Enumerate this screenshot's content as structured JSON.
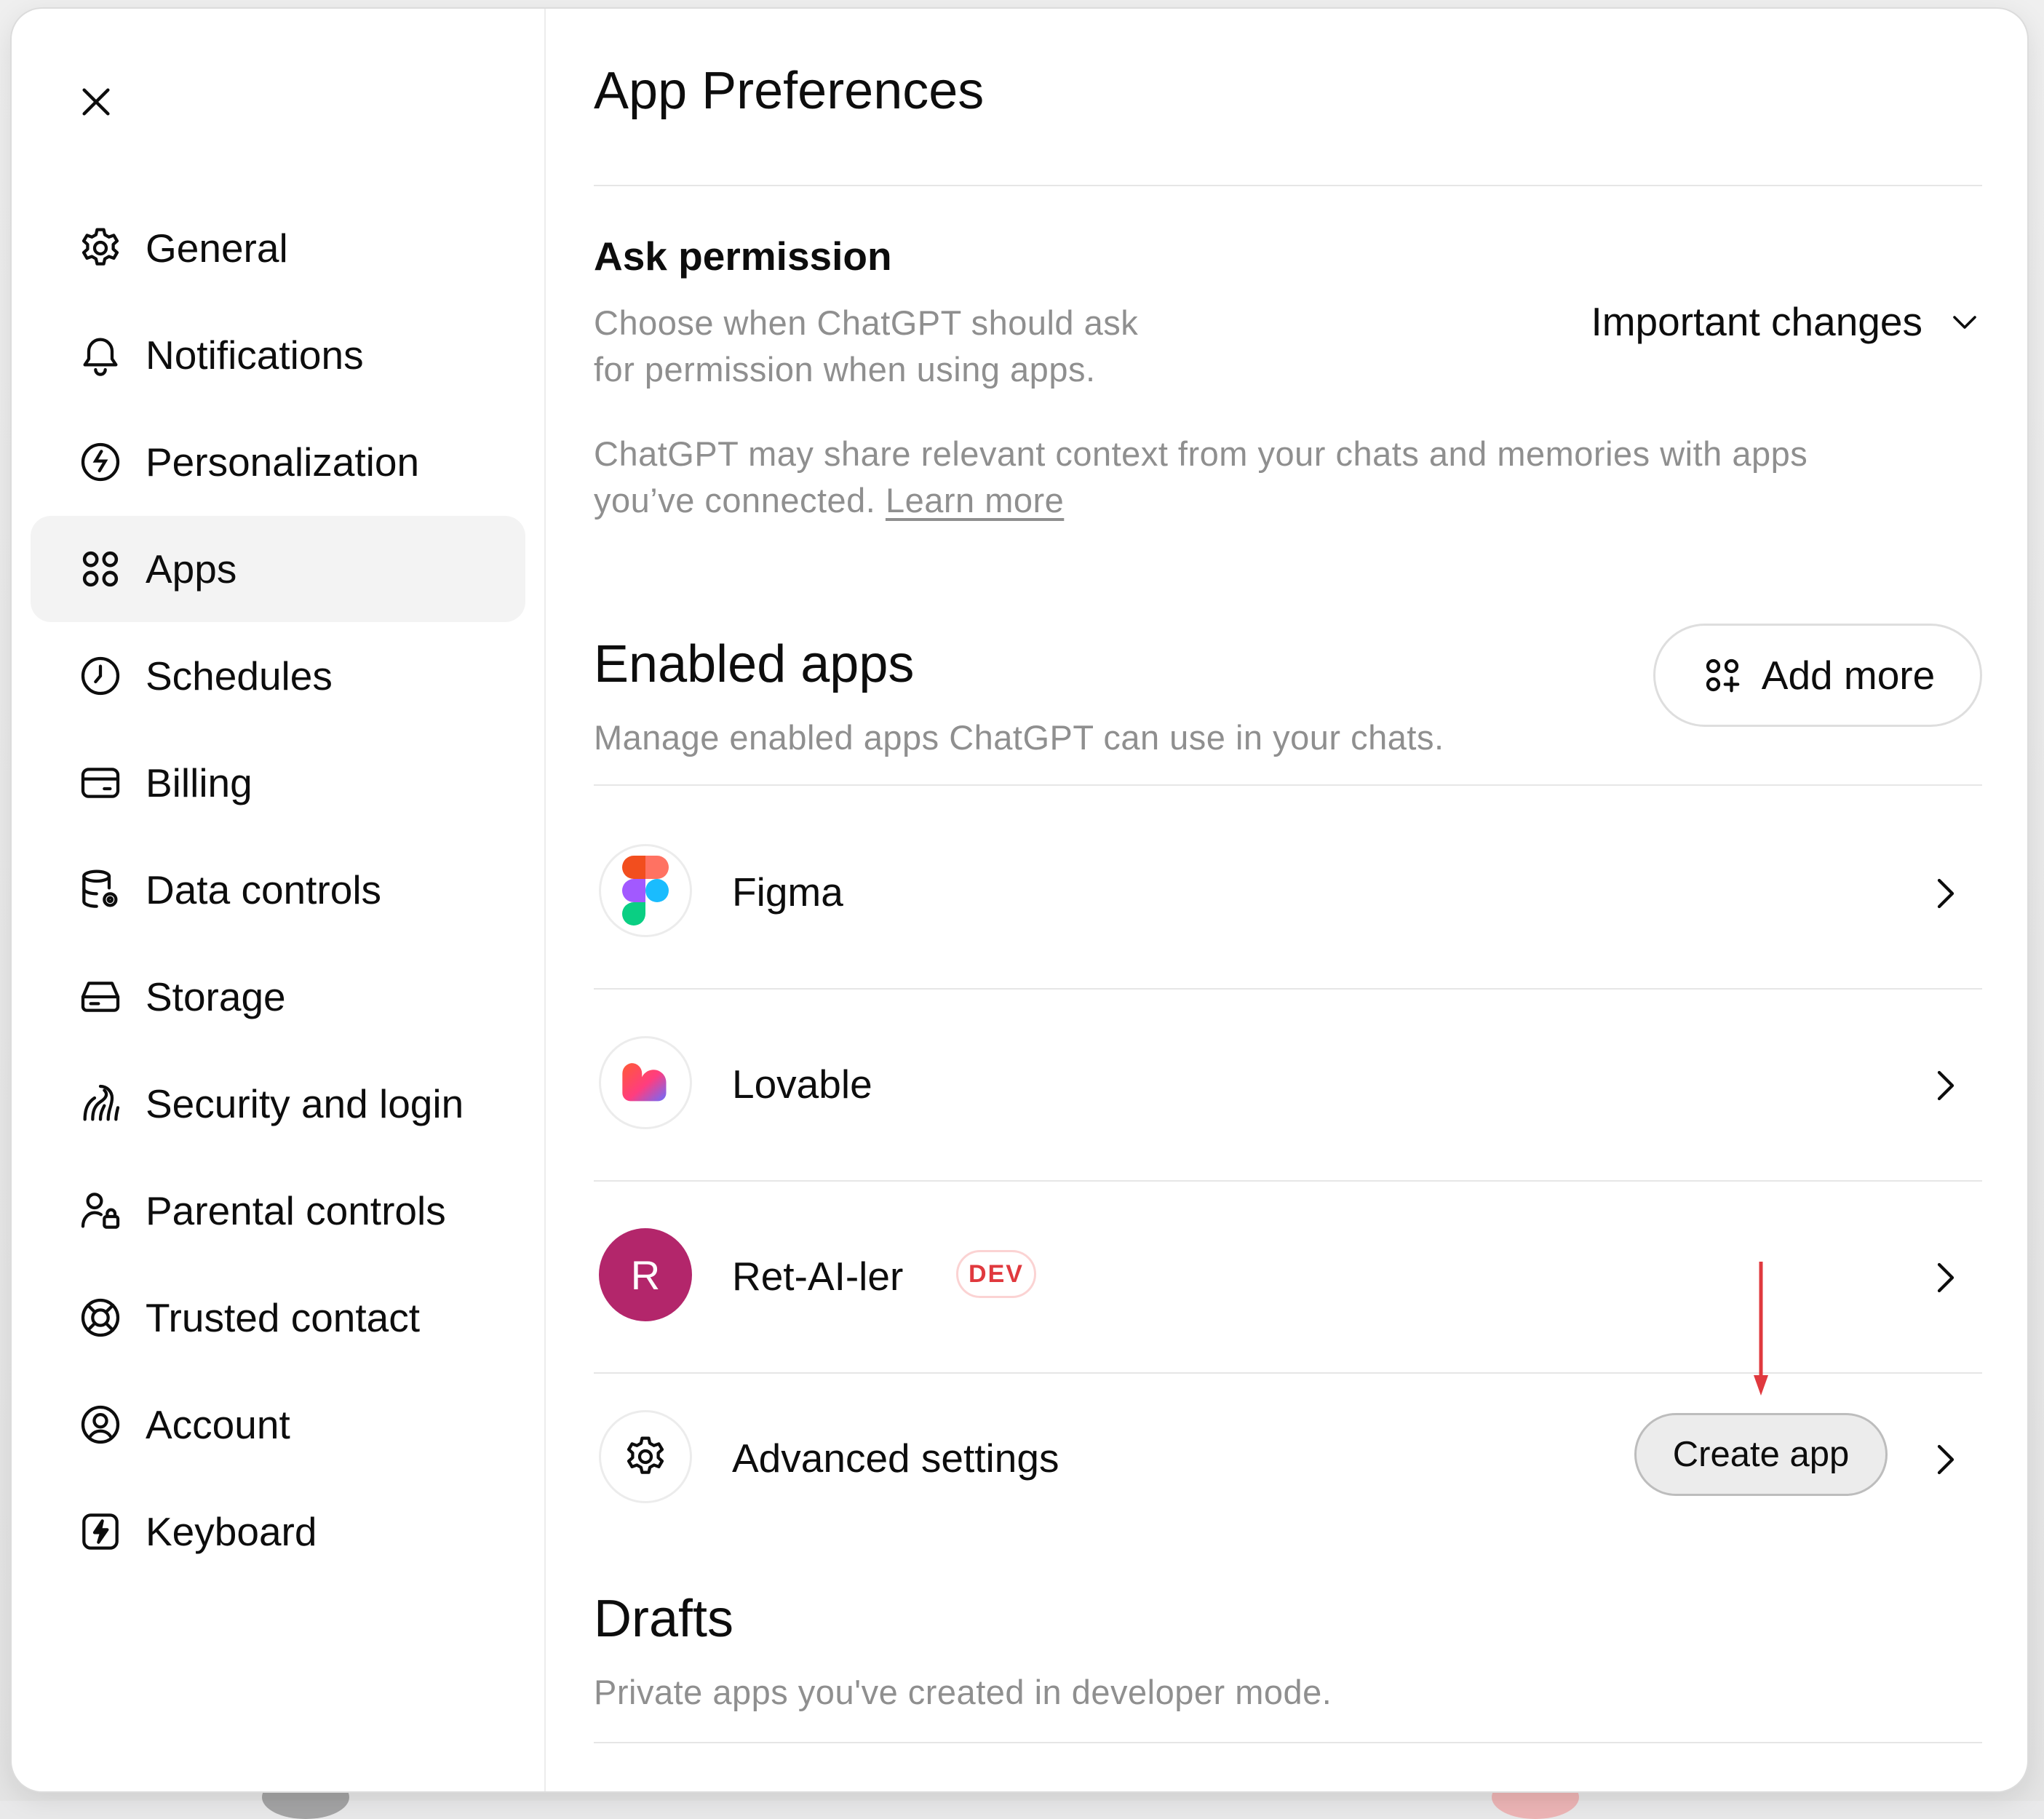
{
  "window": {
    "title": "App Preferences"
  },
  "sidebar": {
    "items": [
      {
        "label": "General",
        "icon": "gear-icon"
      },
      {
        "label": "Notifications",
        "icon": "bell-icon"
      },
      {
        "label": "Personalization",
        "icon": "personalization-icon"
      },
      {
        "label": "Apps",
        "icon": "apps-grid-icon",
        "active": true
      },
      {
        "label": "Schedules",
        "icon": "clock-icon"
      },
      {
        "label": "Billing",
        "icon": "credit-card-icon"
      },
      {
        "label": "Data controls",
        "icon": "database-gear-icon"
      },
      {
        "label": "Storage",
        "icon": "storage-drive-icon"
      },
      {
        "label": "Security and login",
        "icon": "security-icon"
      },
      {
        "label": "Parental controls",
        "icon": "parental-lock-icon"
      },
      {
        "label": "Trusted contact",
        "icon": "lifebuoy-icon"
      },
      {
        "label": "Account",
        "icon": "account-circle-icon"
      },
      {
        "label": "Keyboard",
        "icon": "keyboard-bolt-icon"
      }
    ]
  },
  "permission": {
    "title": "Ask permission",
    "description_line1": "Choose when ChatGPT should ask",
    "description_line2": "for permission when using apps.",
    "selected_value": "Important changes",
    "note_line1": "ChatGPT may share relevant context from your chats and memories with apps",
    "note_line2_prefix": "you’ve connected.",
    "learn_more": "Learn more"
  },
  "enabled_apps": {
    "title": "Enabled apps",
    "subtitle": "Manage enabled apps ChatGPT can use in your chats.",
    "add_more_label": "Add more",
    "apps": [
      {
        "name": "Figma",
        "logo": "figma-logo"
      },
      {
        "name": "Lovable",
        "logo": "lovable-logo"
      },
      {
        "name": "Ret-AI-ler",
        "logo_letter": "R",
        "badge": "DEV",
        "logo_color": "#b3266b"
      }
    ]
  },
  "advanced": {
    "label": "Advanced settings",
    "create_app_label": "Create app"
  },
  "drafts": {
    "title": "Drafts",
    "subtitle": "Private apps you've created in developer mode."
  },
  "colors": {
    "accent_red": "#e0393e",
    "app_avatar": "#b3266b",
    "muted_text": "#8f8f8f"
  }
}
